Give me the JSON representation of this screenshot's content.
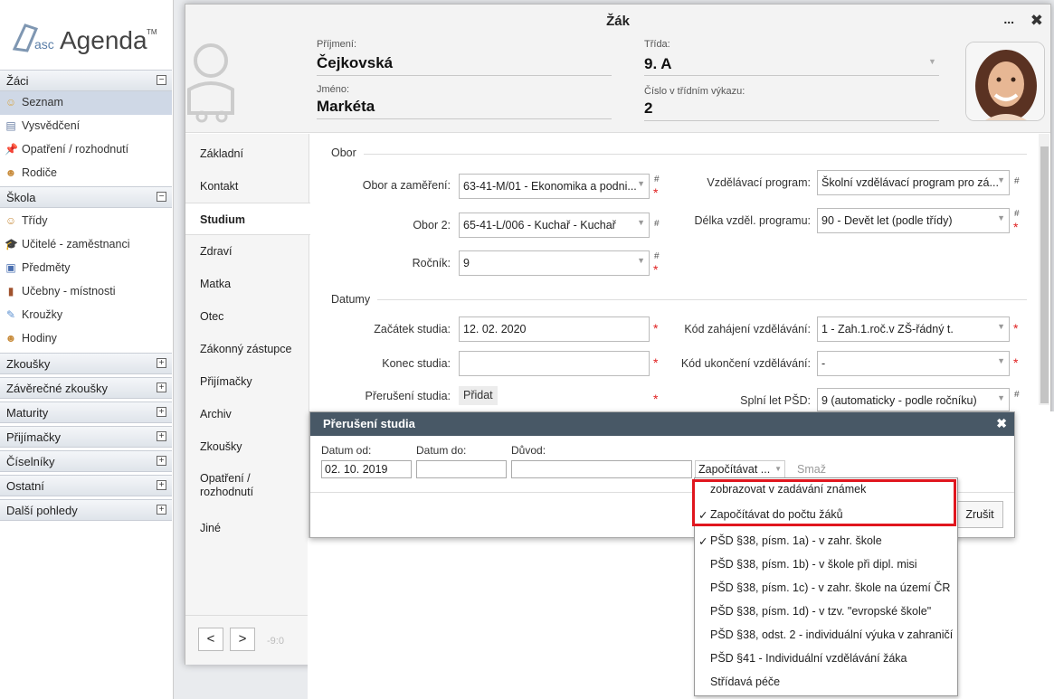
{
  "app": {
    "logo": {
      "prefix": "asc",
      "name": "Agenda",
      "tm": "TM"
    },
    "sidebar": {
      "sections": [
        {
          "label": "Žáci",
          "toggle": "⊟",
          "items": [
            {
              "label": "Seznam",
              "icon": "student-icon"
            },
            {
              "label": "Vysvědčení",
              "icon": "certificate-icon"
            },
            {
              "label": "Opatření / rozhodnutí",
              "icon": "pin-icon"
            },
            {
              "label": "Rodiče",
              "icon": "parents-icon"
            }
          ]
        },
        {
          "label": "Škola",
          "toggle": "⊟",
          "items": [
            {
              "label": "Třídy",
              "icon": "class-icon"
            },
            {
              "label": "Učitelé - zaměstnanci",
              "icon": "teacher-icon"
            },
            {
              "label": "Předměty",
              "icon": "subject-icon"
            },
            {
              "label": "Učebny - místnosti",
              "icon": "room-icon"
            },
            {
              "label": "Kroužky",
              "icon": "club-icon"
            },
            {
              "label": "Hodiny",
              "icon": "hours-icon"
            }
          ]
        },
        {
          "label": "Zkoušky",
          "toggle": "+"
        },
        {
          "label": "Závěrečné zkoušky",
          "toggle": "+"
        },
        {
          "label": "Maturity",
          "toggle": "+"
        },
        {
          "label": "Přijímačky",
          "toggle": "+"
        },
        {
          "label": "Číselníky",
          "toggle": "+"
        },
        {
          "label": "Ostatní",
          "toggle": "+"
        },
        {
          "label": "Další pohledy",
          "toggle": "+"
        }
      ]
    }
  },
  "dialog": {
    "title": "Žák",
    "more": "...",
    "close": "✖",
    "header": {
      "surname_label": "Příjmení:",
      "surname": "Čejkovská",
      "name_label": "Jméno:",
      "name": "Markéta",
      "class_label": "Třída:",
      "class": "9. A",
      "number_label": "Číslo v třídním výkazu:",
      "number": "2"
    },
    "tabs": [
      "Základní",
      "Kontakt",
      "Studium",
      "Zdraví",
      "Matka",
      "Otec",
      "Zákonný zástupce",
      "Přijímačky",
      "Archiv",
      "Zkoušky",
      "Opatření / rozhodnutí",
      "Jiné"
    ],
    "nav": {
      "prev": "<",
      "next": ">",
      "version": "-9:0"
    },
    "obor": {
      "group": "Obor",
      "obor_label": "Obor a zaměření:",
      "obor_value": "63-41-M/01 - Ekonomika a podni...",
      "obor2_label": "Obor 2:",
      "obor2_value": "65-41-L/006 - Kuchař - Kuchař",
      "rocnik_label": "Ročník:",
      "rocnik_value": "9",
      "program_label": "Vzdělávací program:",
      "program_value": "Školní vzdělávací program pro zá...",
      "delka_label": "Délka vzděl. programu:",
      "delka_value": "90 - Devět let (podle třídy)"
    },
    "datumy": {
      "group": "Datumy",
      "zacatek_label": "Začátek studia:",
      "zacatek_value": "12. 02. 2020",
      "konec_label": "Konec studia:",
      "konec_value": "",
      "preruseni_label": "Přerušení studia:",
      "preruseni_button": "Přidat",
      "kod_zah_label": "Kód zahájení vzdělávání:",
      "kod_zah_value": "1 - Zah.1.roč.v ZŠ-řádný t.",
      "kod_uk_label": "Kód ukončení vzdělávání:",
      "kod_uk_value": "-",
      "psd_label": "Splní let PŠD:",
      "psd_value": "9 (automaticky - podle ročníku)"
    },
    "marks": {
      "hash": "#",
      "required": "*"
    }
  },
  "interruption": {
    "title": "Přerušení studia",
    "close": "✖",
    "from_label": "Datum od:",
    "from_value": "02. 10. 2019",
    "to_label": "Datum do:",
    "to_value": "",
    "reason_label": "Důvod:",
    "reason_value": "",
    "count_select": "Započítávat ...",
    "delete": "Smaž",
    "cancel": "Zrušit"
  },
  "dropdown": {
    "items": [
      {
        "label": "zobrazovat v zadávání známek",
        "checked": false
      },
      {
        "label": "Započítávat do počtu žáků",
        "checked": true
      },
      {
        "label": "PŠD §38, písm. 1a) - v zahr. škole",
        "checked": true
      },
      {
        "label": "PŠD §38, písm. 1b) - v škole při dipl. misi",
        "checked": false
      },
      {
        "label": "PŠD §38, písm. 1c) - v zahr. škole na území ČR",
        "checked": false
      },
      {
        "label": "PŠD §38, písm. 1d) - v tzv. \"evropské škole\"",
        "checked": false
      },
      {
        "label": "PŠD §38, odst. 2 - individuální výuka v zahraničí",
        "checked": false
      },
      {
        "label": "PŠD §41 - Individuální vzdělávání žáka",
        "checked": false
      },
      {
        "label": "Střídavá péče",
        "checked": false
      }
    ],
    "checkmark": "✓"
  },
  "colors": {
    "dialog_header": "#485866",
    "highlight": "#e0161e",
    "required": "#e02020"
  }
}
